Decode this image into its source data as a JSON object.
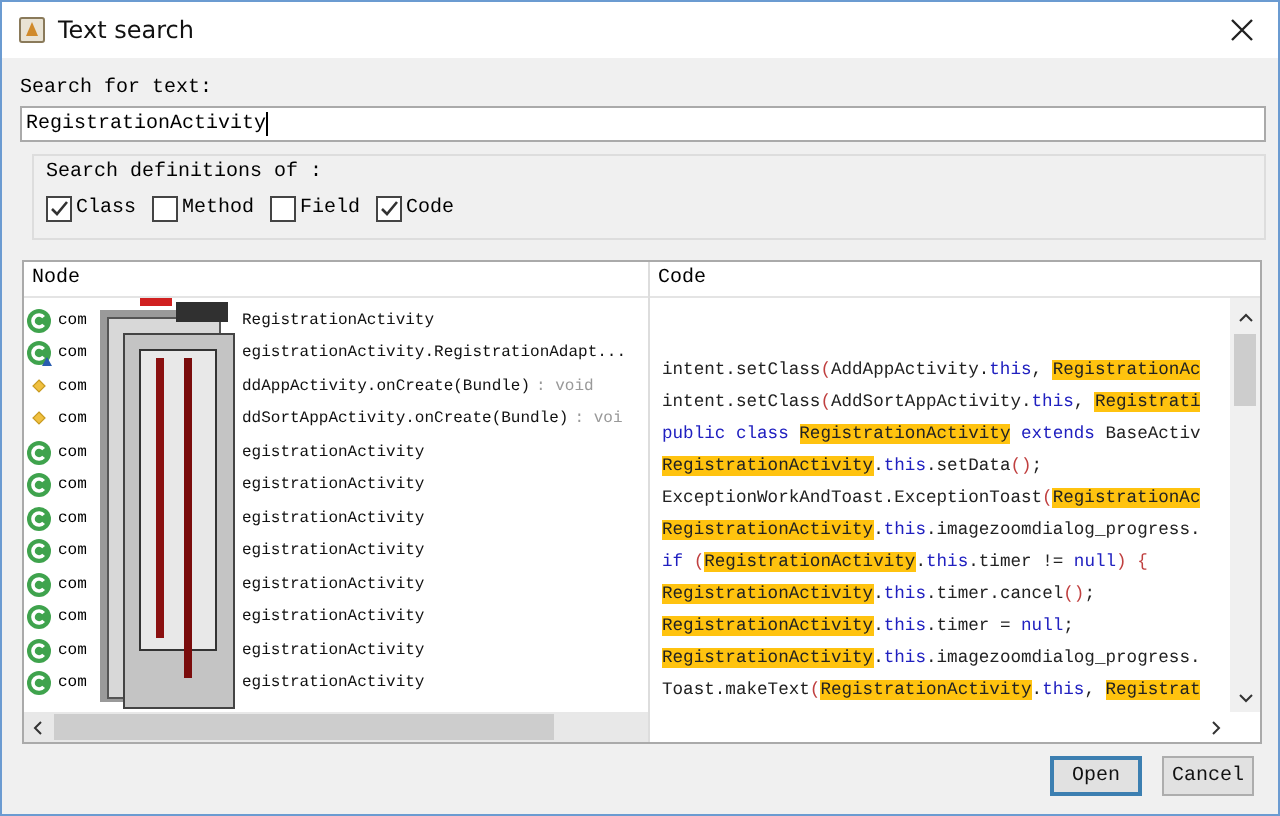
{
  "window": {
    "title": "Text search"
  },
  "search": {
    "label": "Search for text:",
    "value": "RegistrationActivity"
  },
  "definitions": {
    "title": "Search definitions of :",
    "options": [
      {
        "label": "Class",
        "checked": true
      },
      {
        "label": "Method",
        "checked": false
      },
      {
        "label": "Field",
        "checked": false
      },
      {
        "label": "Code",
        "checked": true
      }
    ]
  },
  "results": {
    "columns": [
      "Node",
      "Code"
    ],
    "nodes": [
      {
        "kind": "class",
        "prefix": "com",
        "name": "RegistrationActivity"
      },
      {
        "kind": "inner-class",
        "prefix": "com",
        "name": "egistrationActivity.RegistrationAdapt..."
      },
      {
        "kind": "method",
        "prefix": "com",
        "name": "ddAppActivity.onCreate(Bundle)",
        "suffix": ": void"
      },
      {
        "kind": "method",
        "prefix": "com",
        "name": "ddSortAppActivity.onCreate(Bundle)",
        "suffix": ": voi"
      },
      {
        "kind": "class",
        "prefix": "com",
        "name": "egistrationActivity"
      },
      {
        "kind": "class",
        "prefix": "com",
        "name": "egistrationActivity"
      },
      {
        "kind": "class",
        "prefix": "com",
        "name": "egistrationActivity"
      },
      {
        "kind": "class",
        "prefix": "com",
        "name": "egistrationActivity"
      },
      {
        "kind": "class",
        "prefix": "com",
        "name": "egistrationActivity"
      },
      {
        "kind": "class",
        "prefix": "com",
        "name": "egistrationActivity"
      },
      {
        "kind": "class",
        "prefix": "com",
        "name": "egistrationActivity"
      },
      {
        "kind": "class",
        "prefix": "com",
        "name": "egistrationActivity"
      }
    ],
    "code_lines": [
      [
        {
          "kind": "plain",
          "text": "intent.setClass"
        },
        {
          "kind": "paren",
          "text": "("
        },
        {
          "kind": "plain",
          "text": "AddAppActivity."
        },
        {
          "kind": "keyword",
          "text": "this"
        },
        {
          "kind": "plain",
          "text": ", "
        },
        {
          "kind": "match",
          "text": "RegistrationAc"
        }
      ],
      [
        {
          "kind": "plain",
          "text": "intent.setClass"
        },
        {
          "kind": "paren",
          "text": "("
        },
        {
          "kind": "plain",
          "text": "AddSortAppActivity."
        },
        {
          "kind": "keyword",
          "text": "this"
        },
        {
          "kind": "plain",
          "text": ", "
        },
        {
          "kind": "match",
          "text": "Registrati"
        }
      ],
      [
        {
          "kind": "keyword",
          "text": "public class "
        },
        {
          "kind": "match",
          "text": "RegistrationActivity"
        },
        {
          "kind": "keyword",
          "text": " extends"
        },
        {
          "kind": "plain",
          "text": " BaseActiv"
        }
      ],
      [
        {
          "kind": "match",
          "text": "RegistrationActivity"
        },
        {
          "kind": "plain",
          "text": "."
        },
        {
          "kind": "keyword",
          "text": "this"
        },
        {
          "kind": "plain",
          "text": ".setData"
        },
        {
          "kind": "paren",
          "text": "()"
        },
        {
          "kind": "plain",
          "text": ";"
        }
      ],
      [
        {
          "kind": "plain",
          "text": "ExceptionWorkAndToast.ExceptionToast"
        },
        {
          "kind": "paren",
          "text": "("
        },
        {
          "kind": "match",
          "text": "RegistrationAc"
        }
      ],
      [
        {
          "kind": "match",
          "text": "RegistrationActivity"
        },
        {
          "kind": "plain",
          "text": "."
        },
        {
          "kind": "keyword",
          "text": "this"
        },
        {
          "kind": "plain",
          "text": ".imagezoomdialog_progress."
        }
      ],
      [
        {
          "kind": "keyword",
          "text": "if "
        },
        {
          "kind": "paren",
          "text": "("
        },
        {
          "kind": "match",
          "text": "RegistrationActivity"
        },
        {
          "kind": "plain",
          "text": "."
        },
        {
          "kind": "keyword",
          "text": "this"
        },
        {
          "kind": "plain",
          "text": ".timer != "
        },
        {
          "kind": "keyword",
          "text": "null"
        },
        {
          "kind": "paren",
          "text": ") {"
        }
      ],
      [
        {
          "kind": "match",
          "text": "RegistrationActivity"
        },
        {
          "kind": "plain",
          "text": "."
        },
        {
          "kind": "keyword",
          "text": "this"
        },
        {
          "kind": "plain",
          "text": ".timer.cancel"
        },
        {
          "kind": "paren",
          "text": "()"
        },
        {
          "kind": "plain",
          "text": ";"
        }
      ],
      [
        {
          "kind": "match",
          "text": "RegistrationActivity"
        },
        {
          "kind": "plain",
          "text": "."
        },
        {
          "kind": "keyword",
          "text": "this"
        },
        {
          "kind": "plain",
          "text": ".timer = "
        },
        {
          "kind": "keyword",
          "text": "null"
        },
        {
          "kind": "plain",
          "text": ";"
        }
      ],
      [
        {
          "kind": "match",
          "text": "RegistrationActivity"
        },
        {
          "kind": "plain",
          "text": "."
        },
        {
          "kind": "keyword",
          "text": "this"
        },
        {
          "kind": "plain",
          "text": ".imagezoomdialog_progress."
        }
      ],
      [
        {
          "kind": "plain",
          "text": "Toast.makeText"
        },
        {
          "kind": "paren",
          "text": "("
        },
        {
          "kind": "match",
          "text": "RegistrationActivity"
        },
        {
          "kind": "plain",
          "text": "."
        },
        {
          "kind": "keyword",
          "text": "this"
        },
        {
          "kind": "plain",
          "text": ", "
        },
        {
          "kind": "match",
          "text": "Registrat"
        }
      ]
    ]
  },
  "buttons": [
    {
      "label": "Open",
      "default": true
    },
    {
      "label": "Cancel",
      "default": false
    }
  ]
}
